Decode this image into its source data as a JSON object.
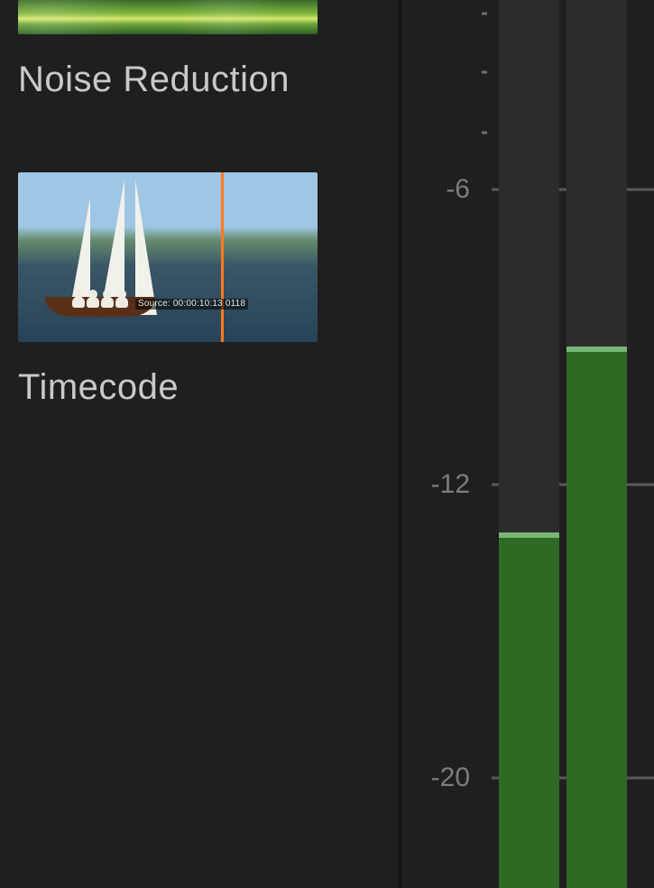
{
  "sidebar": {
    "items": [
      {
        "label": "Noise Reduction"
      },
      {
        "label": "Timecode",
        "overlay_text": "Source: 00:00:10:13\n0118"
      }
    ]
  },
  "meter": {
    "scale_labels": [
      {
        "value": "-6",
        "pos_pct": 21.3
      },
      {
        "value": "-12",
        "pos_pct": 54.6
      },
      {
        "value": "-20",
        "pos_pct": 87.6
      }
    ],
    "minor_tick_pos_pct": [
      1.5,
      8.1,
      14.9
    ],
    "channels": [
      {
        "level_top_pct": 60.0
      },
      {
        "level_top_pct": 39.0
      }
    ],
    "colors": {
      "bar_fill": "#2e6a24",
      "bar_peak": "#78b574",
      "bar_bg": "#2c2c2c",
      "gridline": "#5a5a5a",
      "label": "#7d7d7d"
    }
  }
}
